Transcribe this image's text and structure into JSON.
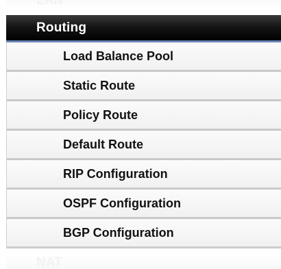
{
  "menu": {
    "prev_section_label": "LAN",
    "section_title": "Routing",
    "items": [
      {
        "label": "Load Balance Pool"
      },
      {
        "label": "Static Route"
      },
      {
        "label": "Policy Route"
      },
      {
        "label": "Default Route"
      },
      {
        "label": "RIP Configuration"
      },
      {
        "label": "OSPF Configuration"
      },
      {
        "label": "BGP Configuration"
      }
    ],
    "next_section_label": "NAT"
  }
}
